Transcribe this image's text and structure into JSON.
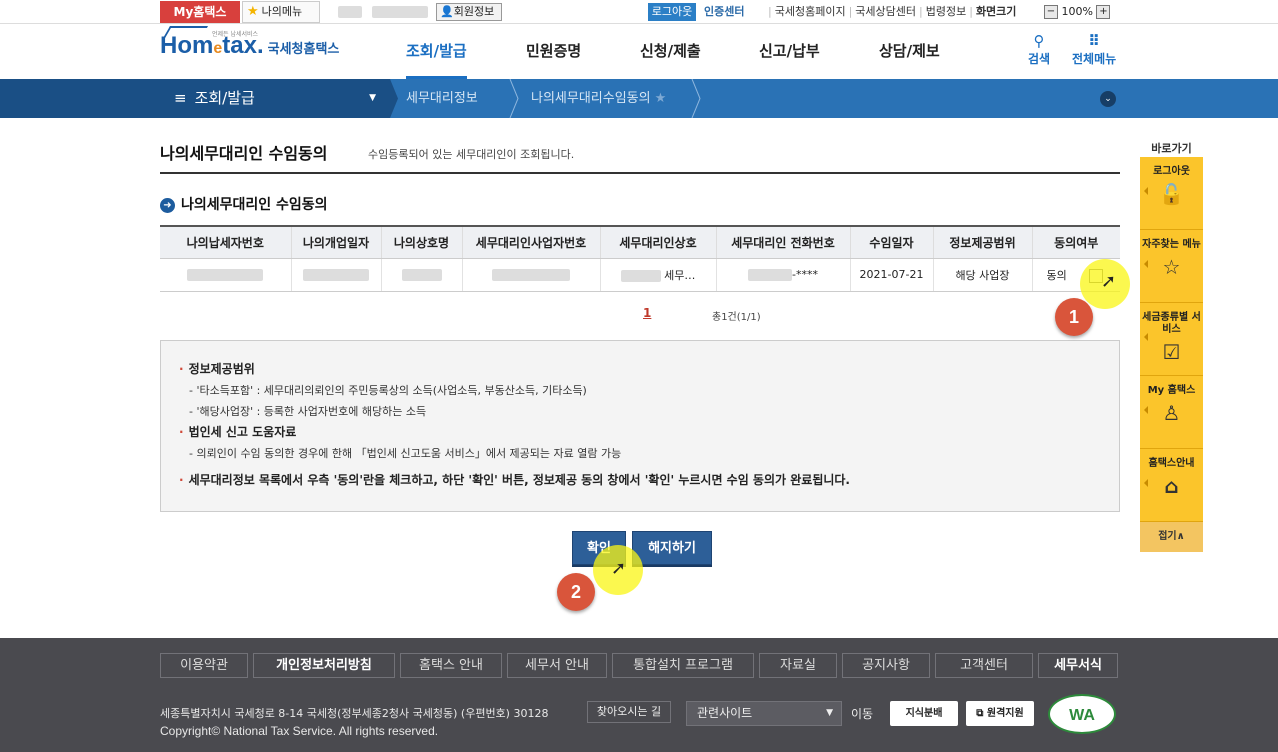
{
  "util": {
    "myhome": "My홈택스",
    "mymenu": "나의메뉴",
    "member_info": "회원정보",
    "logout": "로그아웃",
    "cert_center": "인증센터",
    "links": [
      "국세청홈페이지",
      "국세상담센터",
      "법령정보"
    ],
    "screen_size": "화면크기",
    "zoom": "100%"
  },
  "header": {
    "logo_home": "Hom",
    "logo_e": "e",
    "logo_tax": "tax.",
    "logo_kr": "국세청홈택스",
    "logo_tiny": "언제든 납세서비스",
    "menu": [
      "조회/발급",
      "민원증명",
      "신청/제출",
      "신고/납부",
      "상담/제보"
    ],
    "search": "검색",
    "all_menu": "전체메뉴"
  },
  "location": {
    "menu": "조회/발급",
    "crumb1": "세무대리정보",
    "crumb2": "나의세무대리수임동의"
  },
  "page": {
    "title": "나의세무대리인 수임동의",
    "desc": "수임등록되어 있는 세무대리인이 조회됩니다.",
    "section_title": "나의세무대리인 수임동의"
  },
  "table": {
    "headers": [
      "나의납세자번호",
      "나의개업일자",
      "나의상호명",
      "세무대리인사업자번호",
      "세무대리인상호",
      "세무대리인 전화번호",
      "수임일자",
      "정보제공범위",
      "동의여부"
    ],
    "row": {
      "agent_name_suffix": "세무…",
      "phone_suffix": "-****",
      "date": "2021-07-21",
      "scope": "해당 사업장",
      "consent": "동의"
    }
  },
  "pager": {
    "current": "1",
    "total": "총1건(1/1)"
  },
  "info": {
    "h1": "정보제공범위",
    "l1": "- '타소득포함' : 세무대리의뢰인의 주민등록상의 소득(사업소득, 부동산소득, 기타소득)",
    "l2": "- '해당사업장' : 등록한 사업자번호에 해당하는 소득",
    "h2": "법인세 신고 도움자료",
    "l3": "- 의뢰인이 수임 동의한 경우에 한해 「법인세 신고도움 서비스」에서 제공되는 자료 열람 가능",
    "final": "세무대리정보 목록에서 우측 '동의'란을 체크하고, 하단 '확인' 버튼, 정보제공 동의 창에서 '확인' 누르시면 수임 동의가 완료됩니다."
  },
  "buttons": {
    "confirm": "확인",
    "cancel": "해지하기"
  },
  "markers": {
    "m1": "1",
    "m2": "2"
  },
  "quick": {
    "title": "바로가기",
    "items": [
      "로그아웃",
      "자주찾는 메뉴",
      "세금종류별 서비스",
      "My 홈택스",
      "홈택스안내"
    ],
    "fold": "접기∧"
  },
  "footer": {
    "menu": [
      "이용약관",
      "개인정보처리방침",
      "홈택스 안내",
      "세무서 안내",
      "통합설치 프로그램",
      "자료실",
      "공지사항",
      "고객센터",
      "세무서식"
    ],
    "address": "세종특별자치시 국세청로 8-14 국세청(정부세종2청사 국세청동) (우편번호) 30128",
    "find_way": "찾아오시는 길",
    "related": "관련사이트",
    "go": "이동",
    "badge1": "지식분배",
    "badge2": "원격지원",
    "copyright": "Copyright© National Tax Service. All rights reserved.",
    "wa": "WA"
  },
  "colors": {
    "accent_blue": "#1b6fc2",
    "nav_dark": "#1a4f85",
    "nav_blue": "#2a72b5",
    "quick_yellow": "#fbc52b",
    "marker_red": "#d9553b",
    "footer_bg": "#4a4a4f"
  }
}
